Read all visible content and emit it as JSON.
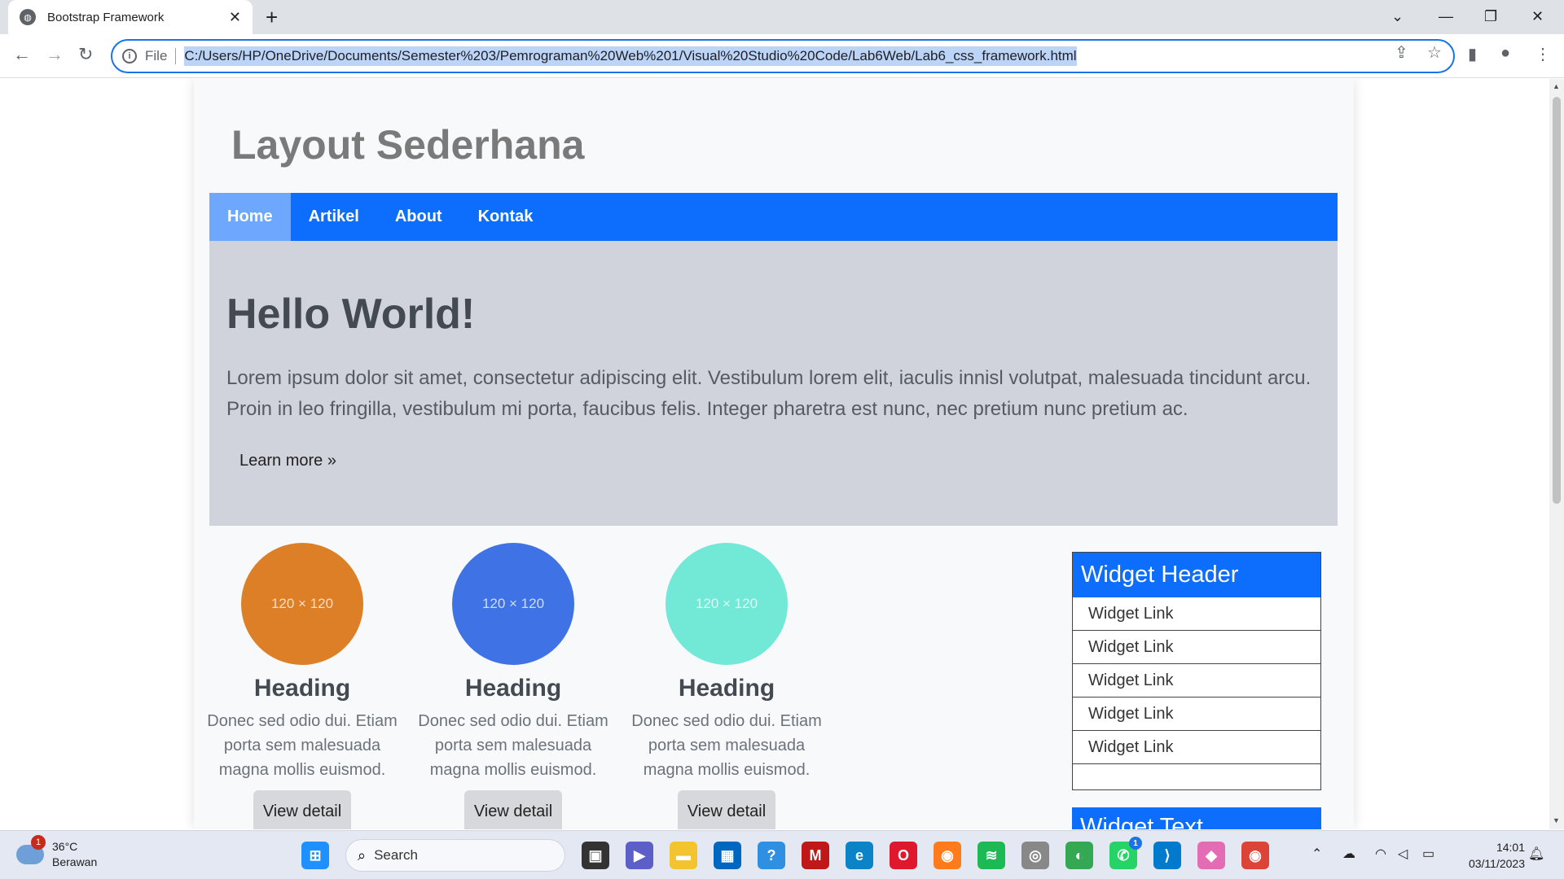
{
  "browser": {
    "tab_title": "Bootstrap Framework",
    "new_tab": "+",
    "scheme": "File",
    "url": "C:/Users/HP/OneDrive/Documents/Semester%203/Pemrograman%20Web%201/Visual%20Studio%20Code/Lab6Web/Lab6_css_framework.html"
  },
  "page": {
    "site_title": "Layout Sederhana",
    "nav": [
      "Home",
      "Artikel",
      "About",
      "Kontak"
    ],
    "hero": {
      "title": "Hello World!",
      "text": "Lorem ipsum dolor sit amet, consectetur adipiscing elit. Vestibulum lorem elit, iaculis innisl volutpat, malesuada tincidunt arcu. Proin in leo fringilla, vestibulum mi porta, faucibus felis. Integer pharetra est nunc, nec pretium nunc pretium ac.",
      "learn_more": "Learn more »"
    },
    "features": [
      {
        "placeholder": "120 × 120",
        "color": "#dd7f27",
        "heading": "Heading",
        "text": "Donec sed odio dui. Etiam porta sem malesuada magna mollis euismod.",
        "button": "View detail"
      },
      {
        "placeholder": "120 × 120",
        "color": "#3f72e5",
        "heading": "Heading",
        "text": "Donec sed odio dui. Etiam porta sem malesuada magna mollis euismod.",
        "button": "View detail"
      },
      {
        "placeholder": "120 × 120",
        "color": "#72e8d6",
        "heading": "Heading",
        "text": "Donec sed odio dui. Etiam porta sem malesuada magna mollis euismod.",
        "button": "View detail"
      }
    ],
    "widget": {
      "header": "Widget Header",
      "links": [
        "Widget Link",
        "Widget Link",
        "Widget Link",
        "Widget Link",
        "Widget Link"
      ]
    },
    "widget2": {
      "header": "Widget Text"
    }
  },
  "taskbar": {
    "weather_badge": "1",
    "temperature": "36°C",
    "condition": "Berawan",
    "search": "Search",
    "whatsapp_badge": "1",
    "time": "14:01",
    "date": "03/11/2023"
  },
  "colors": {
    "nav": "#0d6efd",
    "nav_active": "#6ea8fe",
    "hero_bg": "#d0d3db"
  }
}
